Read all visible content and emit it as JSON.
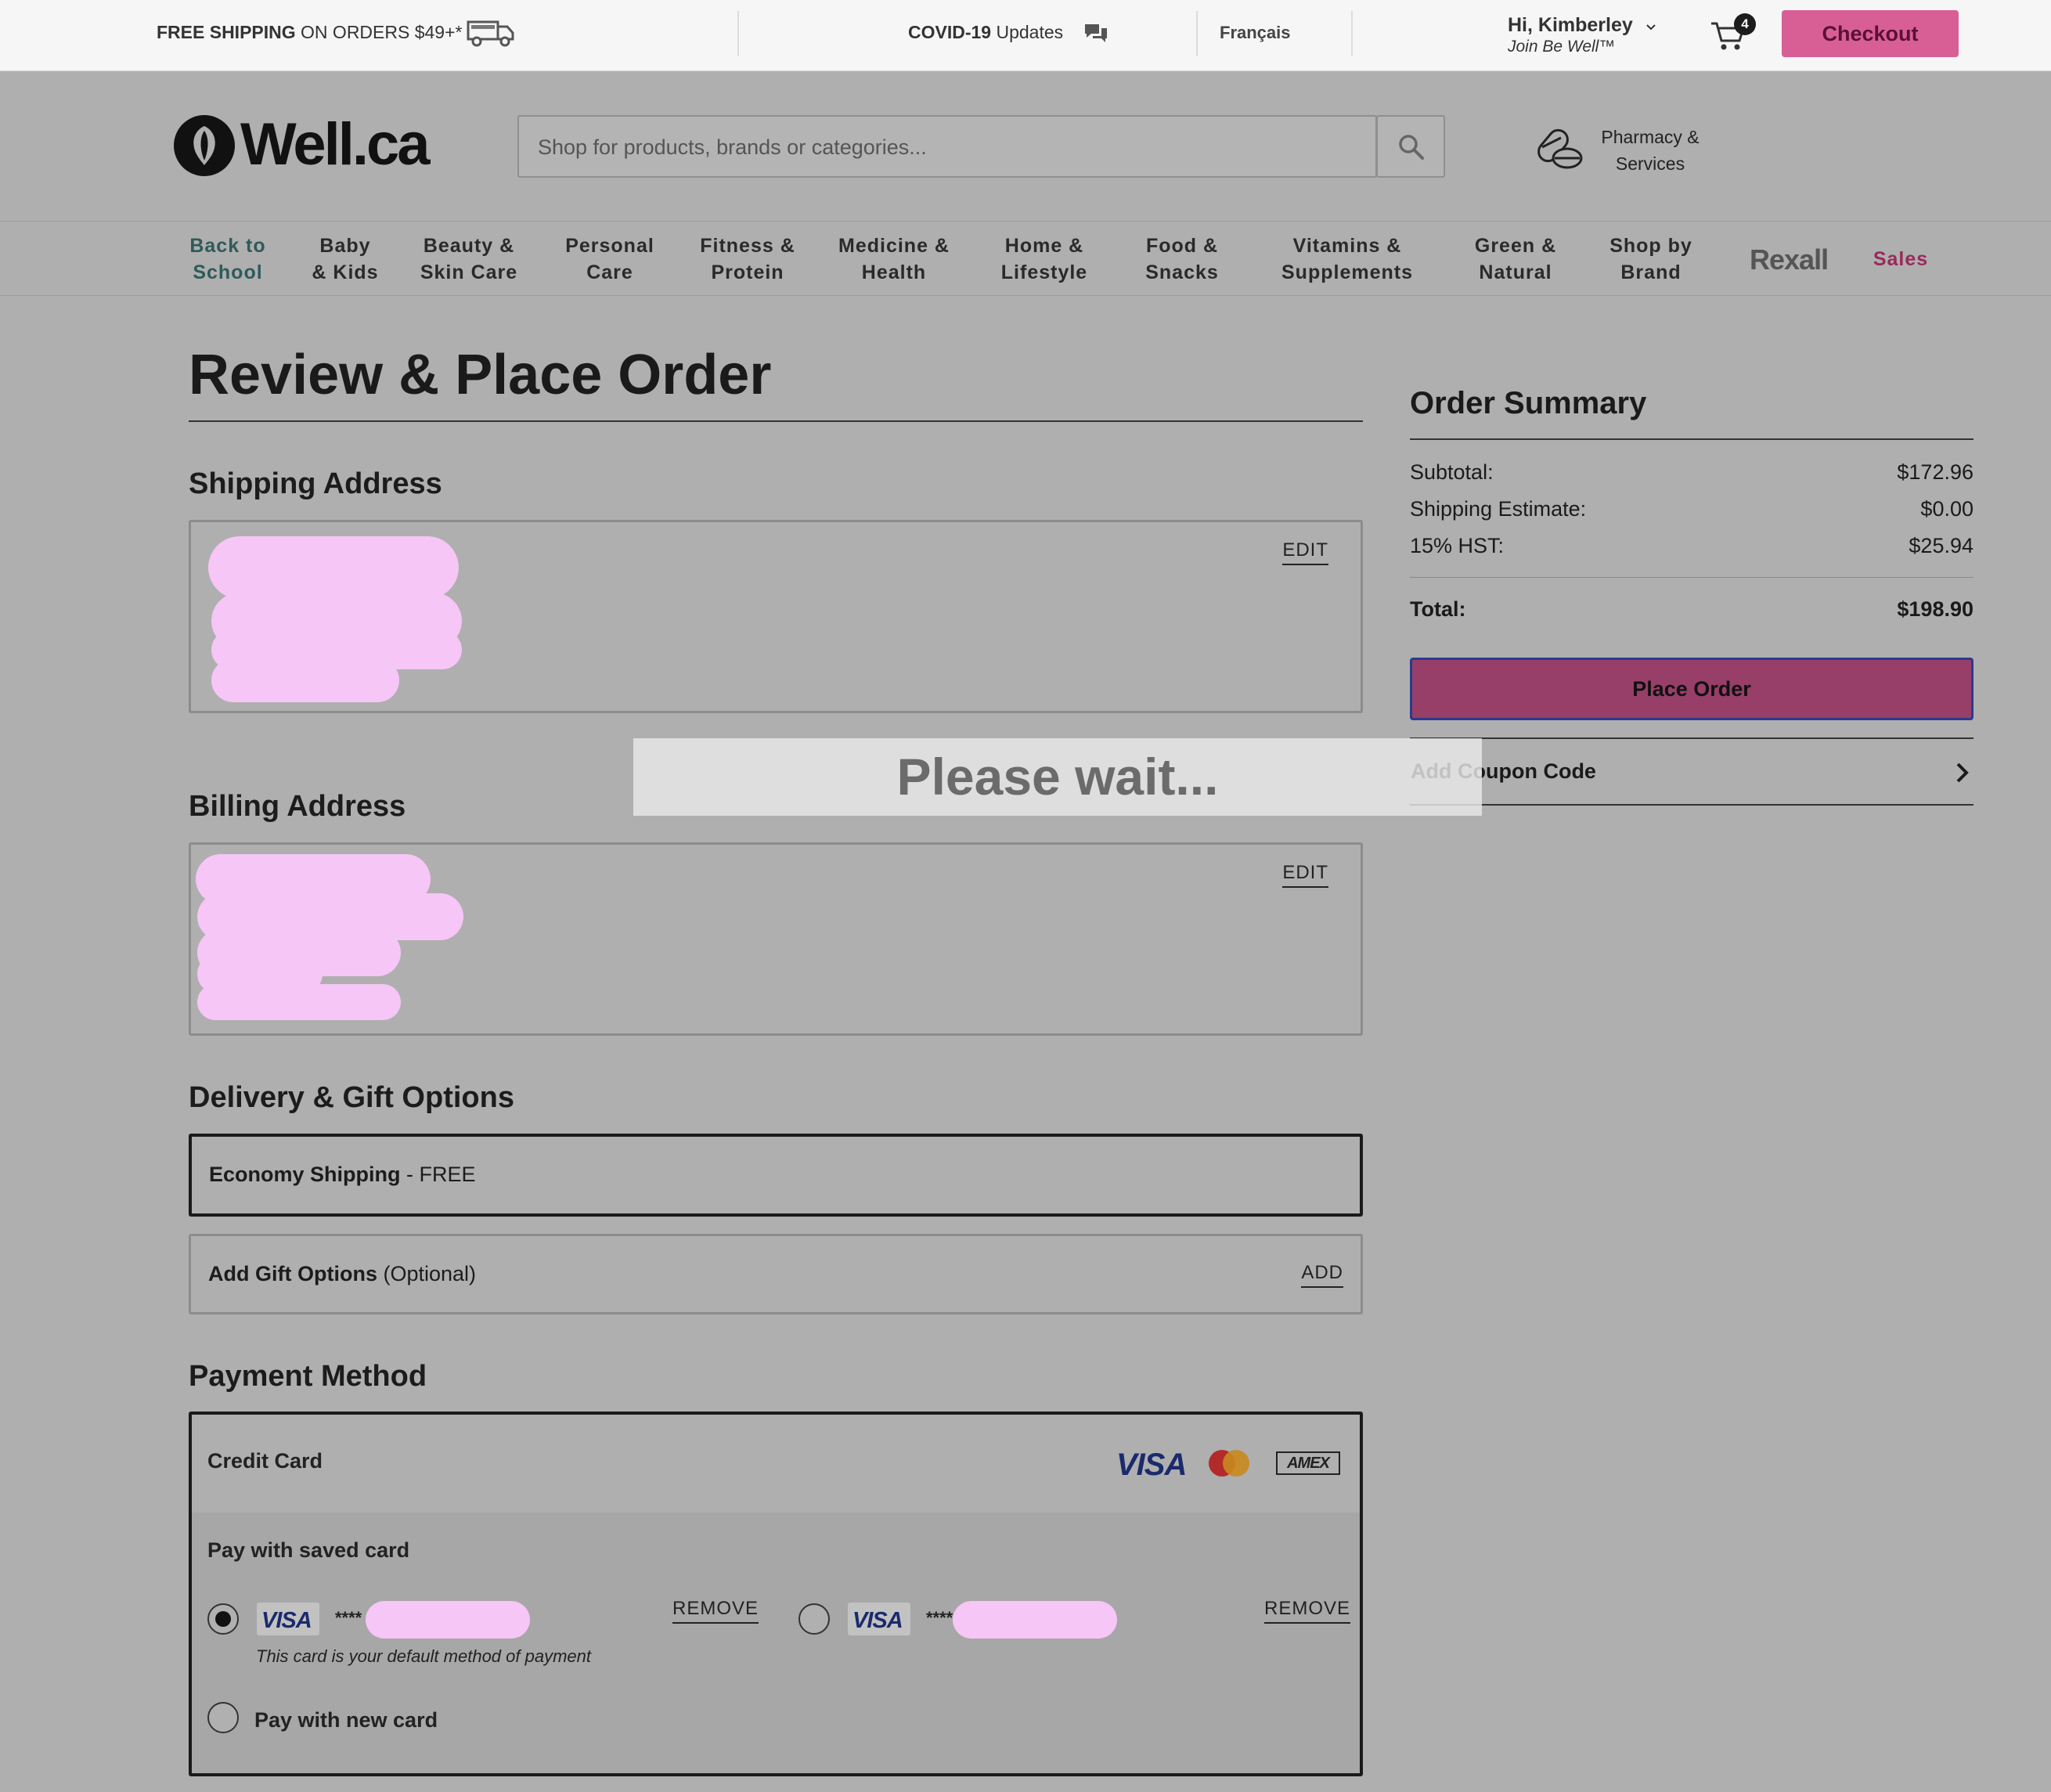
{
  "topbar": {
    "shipping_bold": "FREE SHIPPING",
    "shipping_rest": " ON ORDERS $49+*",
    "covid_bold": "COVID-19",
    "covid_rest": " Updates",
    "language": "Français",
    "greeting": "Hi, Kimberley",
    "membership": "Join Be Well™",
    "cart_count": "4",
    "checkout_label": "Checkout"
  },
  "header": {
    "logo_text": "Well.ca",
    "search_placeholder": "Shop for products, brands or categories...",
    "pharmacy_line1": "Pharmacy &",
    "pharmacy_line2": "Services"
  },
  "nav": {
    "items": [
      {
        "line1": "Back to",
        "line2": "School"
      },
      {
        "line1": "Baby",
        "line2": "& Kids"
      },
      {
        "line1": "Beauty &",
        "line2": "Skin Care"
      },
      {
        "line1": "Personal",
        "line2": "Care"
      },
      {
        "line1": "Fitness &",
        "line2": "Protein"
      },
      {
        "line1": "Medicine &",
        "line2": "Health"
      },
      {
        "line1": "Home &",
        "line2": "Lifestyle"
      },
      {
        "line1": "Food &",
        "line2": "Snacks"
      },
      {
        "line1": "Vitamins &",
        "line2": "Supplements"
      },
      {
        "line1": "Green &",
        "line2": "Natural"
      },
      {
        "line1": "Shop by",
        "line2": "Brand"
      }
    ],
    "rexall": "Rexall",
    "sales": "Sales"
  },
  "page": {
    "title": "Review & Place Order"
  },
  "shipping_address": {
    "title": "Shipping Address",
    "edit_label": "EDIT"
  },
  "billing_address": {
    "title": "Billing Address",
    "edit_label": "EDIT"
  },
  "delivery": {
    "title": "Delivery & Gift Options",
    "shipping_method": "Economy Shipping",
    "shipping_cost": " - FREE",
    "gift_label": "Add Gift Options",
    "gift_optional": " (Optional)",
    "gift_add": "ADD"
  },
  "payment": {
    "title": "Payment Method",
    "credit_card_label": "Credit Card",
    "card_brands": [
      "VISA",
      "AMEX"
    ],
    "saved_label": "Pay with saved card",
    "saved_cards": [
      {
        "brand": "VISA",
        "masked": "****",
        "remove": "REMOVE",
        "selected": true
      },
      {
        "brand": "VISA",
        "masked": "****",
        "remove": "REMOVE",
        "selected": false
      }
    ],
    "default_note": "This card is your default method of payment",
    "new_card_label": "Pay with new card"
  },
  "order_summary": {
    "title": "Order Summary",
    "subtotal_label": "Subtotal:",
    "subtotal_value": "$172.96",
    "shipping_label": "Shipping Estimate:",
    "shipping_value": "$0.00",
    "tax_label": "15% HST:",
    "tax_value": "$25.94",
    "total_label": "Total:",
    "total_value": "$198.90",
    "place_order_label": "Place Order",
    "coupon_label": "Add Coupon Code"
  },
  "overlay": {
    "message": "Please wait..."
  },
  "colors": {
    "accent_pink": "#d85f96",
    "place_order": "#973f68",
    "page_dim": "#afafaf",
    "redaction": "#f6c6f6"
  }
}
